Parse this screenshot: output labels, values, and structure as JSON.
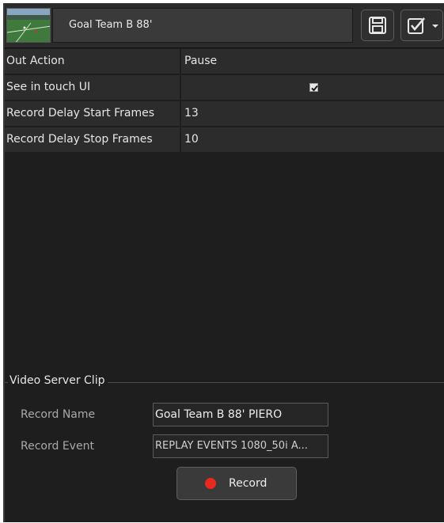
{
  "header": {
    "title": "Goal Team B 88'",
    "thumbnail_icon": "soccer-field-thumbnail",
    "save_icon": "floppy-disk-icon",
    "check_icon": "checkbox-dropdown-icon"
  },
  "properties": [
    {
      "label": "Out Action",
      "value": "Pause"
    },
    {
      "label": "See in touch UI",
      "value": "",
      "checked": true
    },
    {
      "label": "Record Delay Start Frames",
      "value": "13"
    },
    {
      "label": "Record Delay Stop Frames",
      "value": "10"
    }
  ],
  "video_server_clip": {
    "title": "Video Server Clip",
    "record_name_label": "Record Name",
    "record_name_value": "Goal Team B 88' PIERO",
    "record_event_label": "Record Event",
    "record_event_value": "REPLAY EVENTS  1080_50i A...",
    "record_button_label": "Record"
  },
  "colors": {
    "panel_bg": "#1e1e1e",
    "row_bg": "#2c2c2c",
    "record_dot": "#e8291f"
  }
}
